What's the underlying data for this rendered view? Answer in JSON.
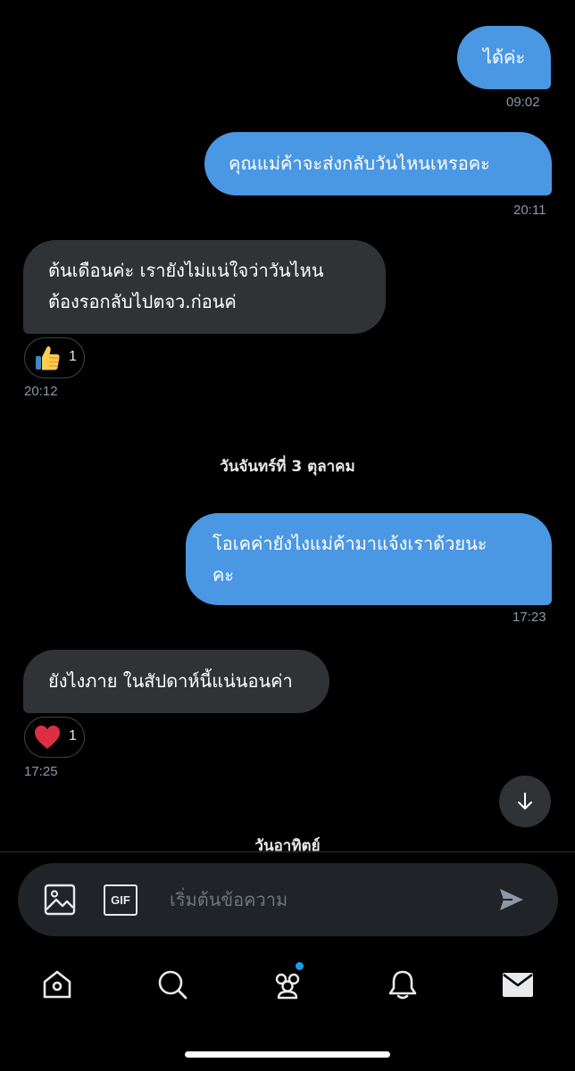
{
  "messages": [
    {
      "direction": "out",
      "text": "ได้ค่ะ",
      "time": "09:02"
    },
    {
      "direction": "out",
      "text": "คุณแม่ค้าจะส่งกลับวันไหนเหรอคะ",
      "time": "20:11"
    },
    {
      "direction": "in",
      "lines": [
        "ต้นเดือนค่ะ เรายังไม่แน่ใจว่าวันไหน",
        "ต้องรอกลับไปตจว.ก่อนค่"
      ],
      "time": "20:12",
      "reaction": {
        "icon": "thumbs-up-emoji",
        "count": "1"
      }
    },
    {
      "direction": "out",
      "lines": [
        "โอเคค่ายังไงแม่ค้ามาแจ้งเราด้วยนะ",
        "คะ"
      ],
      "time": "17:23"
    },
    {
      "direction": "in",
      "text": "ยังไงภาย ในสัปดาห์นี้แน่นอนค่า",
      "time": "17:25",
      "reaction": {
        "icon": "heart-emoji",
        "count": "1"
      }
    }
  ],
  "date_separators": [
    "วันจันทร์ที่ 3 ตุลาคม",
    "วันอาทิตย์"
  ],
  "composer": {
    "placeholder": "เริ่มต้นข้อความ",
    "gif_label": "GIF"
  },
  "tabs": [
    "home",
    "search",
    "communities",
    "notifications",
    "messages"
  ],
  "colors": {
    "background": "#000000",
    "outgoing_bubble": "#4a97e4",
    "incoming_bubble": "#2f3336",
    "timestamp": "#8b98a5",
    "accent": "#1d9bf0"
  }
}
